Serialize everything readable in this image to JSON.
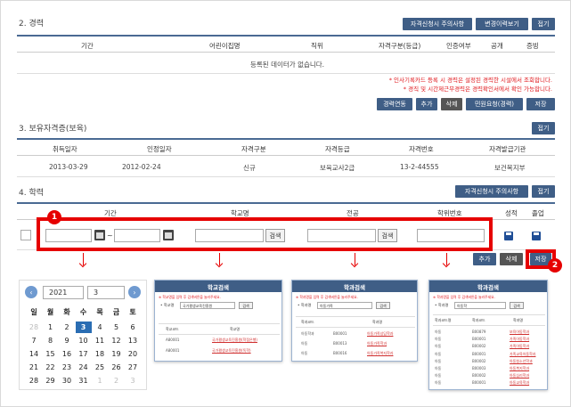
{
  "career": {
    "title": "2. 경력",
    "buttons": [
      "자격신청시 주의사항",
      "변경이력보기",
      "접기"
    ],
    "columns": [
      "기간",
      "어린이집명",
      "직위",
      "자격구분(등급)",
      "인증여부",
      "공개",
      "증빙"
    ],
    "empty_text": "등록된 데이터가 없습니다.",
    "notes": [
      "* 인사기록카드 등록 시 경력은 설정된 경력한 시설에서 조회합니다.",
      "* 경직 및 시간제근무경력은 경력확인서에서 확인 가능합니다."
    ],
    "actions": [
      "경력연동",
      "추가",
      "삭제",
      "민원요청(경력)",
      "저장"
    ]
  },
  "cert": {
    "title": "3. 보유자격증(보육)",
    "button": "접기",
    "columns": [
      "취득일자",
      "인정일자",
      "자격구분",
      "자격등급",
      "자격번호",
      "자격발급기관"
    ],
    "row": [
      "2013-03-29",
      "2012-02-24",
      "신규",
      "보육교사2급",
      "13-2-44555",
      "보건복지부"
    ]
  },
  "edu": {
    "title": "4. 학력",
    "buttons": [
      "자격신청시 주의사항",
      "접기"
    ],
    "columns": [
      "기간",
      "학교명",
      "전공",
      "학위번호",
      "성적",
      "졸업"
    ],
    "tilde": "~",
    "search_label": "검색",
    "actions": [
      "추가",
      "삭제",
      "저장"
    ],
    "badges": [
      "1",
      "2"
    ]
  },
  "calendar": {
    "year": "2021",
    "month": "3",
    "prev": "‹",
    "next": "›",
    "weekdays": [
      "일",
      "월",
      "화",
      "수",
      "목",
      "금",
      "토"
    ],
    "weeks": [
      [
        "28",
        "1",
        "2",
        "3",
        "4",
        "5",
        "6"
      ],
      [
        "7",
        "8",
        "9",
        "10",
        "11",
        "12",
        "13"
      ],
      [
        "14",
        "15",
        "16",
        "17",
        "18",
        "19",
        "20"
      ],
      [
        "21",
        "22",
        "23",
        "24",
        "25",
        "26",
        "27"
      ],
      [
        "28",
        "29",
        "30",
        "31",
        "1",
        "2",
        "3"
      ]
    ],
    "selected": "3"
  },
  "school_popup": {
    "title": "학교검색",
    "note": "※ 학교명을 입력 후 검색버튼을 눌러주세요.",
    "label": "• 학교명",
    "value": "국가평생교육진흥원",
    "search": "검색",
    "cols": [
      "학교코드",
      "학교명"
    ],
    "rows": [
      [
        "A80001",
        "국가평생교육진흥원(학점은행)"
      ],
      [
        "A80001",
        "국가평생교육진흥원(독학)"
      ]
    ]
  },
  "major_popup": {
    "title": "학과검색",
    "note": "※ 학과명을 입력 후 검색버튼을 눌러주세요.",
    "label": "• 학과명",
    "value": "아동가족",
    "search": "검색",
    "cols": [
      "학과코드",
      "학과명"
    ],
    "rows": [
      [
        "아동학과",
        "B00001",
        "아동가족상담학과"
      ],
      [
        "아동",
        "B00013",
        "아동가족학과"
      ],
      [
        "아동",
        "B00016",
        "아동가족복지학과"
      ]
    ]
  },
  "degree_popup": {
    "title": "학과검색",
    "note": "※ 학과명을 입력 후 검색버튼을 눌러주세요.",
    "label": "• 학과명",
    "value": "아동학",
    "search": "검색",
    "cols": [
      "학과코드명",
      "학과코드",
      "학과명"
    ],
    "rows": [
      [
        "아동",
        "B00879",
        "보육아동학과"
      ],
      [
        "아동",
        "B00001",
        "가족아동학과"
      ],
      [
        "아동",
        "B00002",
        "가족아동학과"
      ],
      [
        "아동",
        "B00001",
        "가족교육아동학과"
      ],
      [
        "아동",
        "B00002",
        "아동청소년학과"
      ],
      [
        "아동",
        "B00003",
        "아동복지학과"
      ],
      [
        "아동",
        "B00002",
        "아동심리학과"
      ],
      [
        "아동",
        "B00001",
        "아동교육학과"
      ]
    ]
  }
}
